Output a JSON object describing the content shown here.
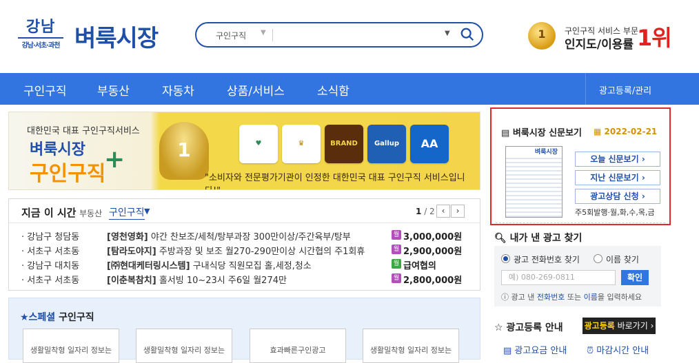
{
  "header": {
    "logo_gangnam": "강남",
    "logo_gangnam_sub": "강남·서초·과천",
    "logo_main": "벼룩시장",
    "search": {
      "category": "구인구직",
      "placeholder": ""
    },
    "rank": {
      "medal_number": "1",
      "sub": "구인구직 서비스 부문",
      "main": "인지도/이용률",
      "num": "1위"
    }
  },
  "nav": {
    "items": [
      "구인구직",
      "부동산",
      "자동차",
      "상품/서비스",
      "소식함"
    ],
    "admin": "광고등록/관리"
  },
  "banner": {
    "line1": "대한민국 대표 구인구직서비스",
    "line2": "벼룩시장",
    "line3": "구인구직",
    "cup_number": "1",
    "badges": [
      "",
      "",
      "BRAND",
      "Gallup",
      "AA"
    ],
    "quote": "\"소비자와 전문평가기관이 인정한 대한민국 대표 구인구직 서비스입니다!\""
  },
  "now": {
    "title": "지금 이 시간",
    "cat1": "부동산",
    "cat2": "구인구직",
    "page_current": "1",
    "page_total": "/ 2",
    "rows": [
      {
        "loc": "· 강남구 청담동",
        "company": "[영천영화]",
        "text": " 야간 찬보조/세척/탕부과장 300만이상/주간육부/탕부",
        "pay_label": "월",
        "amount": "3,000,000원"
      },
      {
        "loc": "· 서초구 서초동",
        "company": "[탐라도야지]",
        "text": " 주방과장 및 보조 월270-290만이상 시간협의 주1회휴",
        "pay_label": "월",
        "amount": "2,900,000원"
      },
      {
        "loc": "· 강남구 대치동",
        "company": "[㈜현대케터링시스템]",
        "text": " 구내식당 직원모집 홀,세정,청소",
        "pay_label": "월",
        "amount": "급여협의"
      },
      {
        "loc": "· 서초구 서초동",
        "company": "[이춘복참치]",
        "text": " 홀서빙 10~23시 주6일 월274만",
        "pay_label": "월",
        "amount": "2,800,000원"
      }
    ]
  },
  "special": {
    "star": "★스페셜",
    "title": "구인구직",
    "cards": [
      "생활밀착형 일자리 정보는",
      "생활밀착형 일자리 정보는",
      "효과빠른구인광고",
      "생활밀착형 일자리 정보는"
    ]
  },
  "paper": {
    "title": "벼룩시장 신문보기",
    "date": "2022-02-21",
    "thumb_title": "벼룩시장",
    "buttons": [
      "오늘 신문보기 ›",
      "지난 신문보기 ›",
      "광고상담 신청 ›"
    ],
    "schedule": "주5회발행·월,화,수,목,금"
  },
  "find": {
    "title": "내가 낸 광고 찾기",
    "radio1": "광고 전화번호 찾기",
    "radio2": "이름 찾기",
    "input_placeholder": "예) 080-269-0811",
    "confirm": "확인",
    "hint_pre": "광고 낸 ",
    "hint_b1": "전화번호",
    "hint_mid": " 또는 ",
    "hint_b2": "이름",
    "hint_post": "을 입력하세요"
  },
  "register": {
    "title": "광고등록 안내",
    "btn_hl": "광고등록",
    "btn_rest": " 바로가기 ›",
    "link1": "광고요금 안내",
    "link2": "마감시간 안내"
  },
  "colors": {
    "brand": "#1f4fa8",
    "nav": "#3275e0",
    "highlight_border": "#e5262b",
    "accent_red": "#e0231f"
  }
}
